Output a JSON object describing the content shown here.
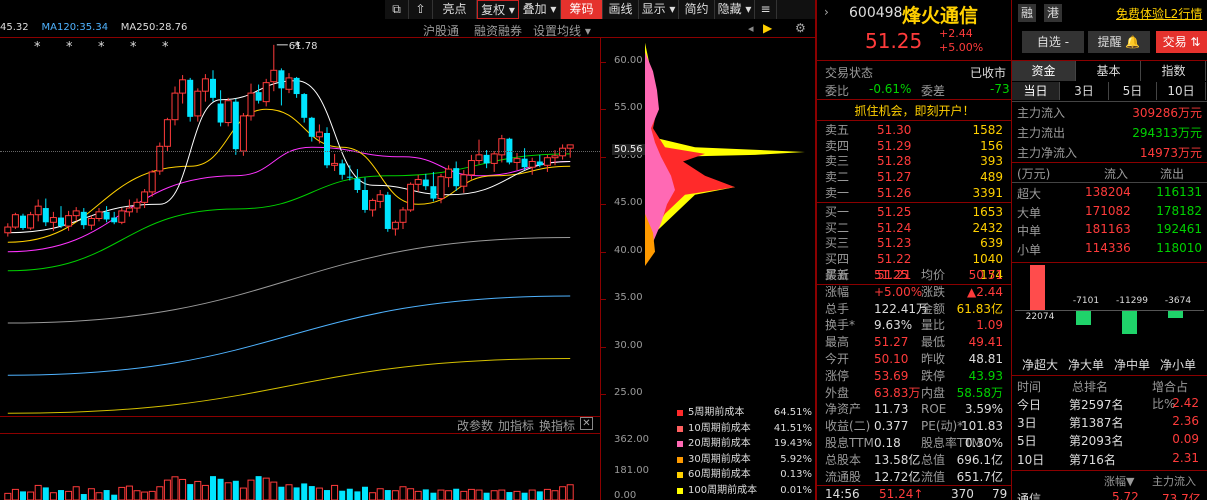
{
  "colors": {
    "up": "#ff3b3b",
    "down": "#00d200",
    "cyan": "#00e5ff",
    "ma5": "#ffffff",
    "ma10": "#ffd000",
    "ma20": "#ff33ff",
    "ma60": "#00d000",
    "ma120": "#9a9a9a",
    "ma250": "#4fb3ff",
    "ma_long": "#d4c000"
  },
  "ma_legend": [
    {
      "text": "45.32",
      "color": "#ddd"
    },
    {
      "text": "MA120:35.34",
      "color": "#4fb3ff"
    },
    {
      "text": "MA250:28.76",
      "color": "#ddd"
    }
  ],
  "toolbar": [
    {
      "label": "",
      "name": "toolbar-icon-button"
    },
    {
      "label": "",
      "name": "toolbar-icon-button-2"
    },
    {
      "label": "亮点",
      "name": "tab-highlights"
    },
    {
      "label": "复权 ▾",
      "name": "tab-adjust",
      "active": "red"
    },
    {
      "label": "叠加 ▾",
      "name": "tab-overlay"
    },
    {
      "label": "筹码",
      "name": "tab-chips",
      "active": "fill"
    },
    {
      "label": "画线",
      "name": "tab-draw"
    },
    {
      "label": "显示 ▾",
      "name": "tab-display"
    },
    {
      "label": "简约",
      "name": "tab-simple"
    },
    {
      "label": "隐藏 ▾",
      "name": "tab-hide"
    },
    {
      "label": "",
      "name": "toolbar-menu-button"
    }
  ],
  "sub_links": [
    "沪股通",
    "融资融券",
    "设置均线 ▾"
  ],
  "peak_label": "61.78",
  "stars": [
    "*",
    "*",
    "*",
    "*",
    "*",
    "*"
  ],
  "price_axis": {
    "ticks": [
      "60.00",
      "55.00",
      "50.00",
      "45.00",
      "40.00",
      "35.00",
      "30.00",
      "25.00"
    ],
    "current": "50.56"
  },
  "volume_axis": {
    "ticks": [
      "362.00",
      "181.00",
      "0.00"
    ]
  },
  "bottom_links": [
    "改参数",
    "加指标",
    "换指标"
  ],
  "chip_legend": [
    {
      "label": "5周期前成本",
      "value": "64.51%",
      "color": "#ff2a2a"
    },
    {
      "label": "10周期前成本",
      "value": "41.51%",
      "color": "#ff6060"
    },
    {
      "label": "20周期前成本",
      "value": "19.43%",
      "color": "#ff69b4"
    },
    {
      "label": "30周期前成本",
      "value": "5.92%",
      "color": "#ff9a00"
    },
    {
      "label": "60周期前成本",
      "value": "0.13%",
      "color": "#ffd000"
    },
    {
      "label": "100周期前成本",
      "value": "0.01%",
      "color": "#ffff00"
    }
  ],
  "chart_data": {
    "type": "candlestick",
    "candles": [
      [
        42,
        43,
        41.6,
        42.6
      ],
      [
        42.6,
        44.1,
        42.4,
        43.9
      ],
      [
        43.8,
        44,
        42.3,
        42.5
      ],
      [
        42.5,
        44.2,
        42.3,
        43.9
      ],
      [
        43.9,
        45.5,
        43.2,
        44.8
      ],
      [
        44.6,
        45.6,
        42.7,
        43.1
      ],
      [
        43.1,
        44.2,
        42.2,
        43.6
      ],
      [
        43.6,
        44.8,
        42.5,
        42.7
      ],
      [
        42.7,
        44.3,
        42.2,
        43.8
      ],
      [
        43.8,
        44.7,
        43.2,
        44.3
      ],
      [
        44.2,
        44.6,
        42.4,
        42.8
      ],
      [
        42.8,
        43.8,
        42.3,
        43.5
      ],
      [
        43.5,
        44.6,
        43.2,
        44.2
      ],
      [
        44.2,
        44.8,
        43.1,
        43.4
      ],
      [
        43.6,
        44.2,
        42.9,
        43.1
      ],
      [
        43.1,
        44.6,
        42.9,
        44.3
      ],
      [
        44.2,
        45.5,
        43.7,
        44.6
      ],
      [
        44.6,
        45.6,
        44.1,
        45.2
      ],
      [
        45.2,
        46.6,
        44.6,
        46.3
      ],
      [
        46.3,
        48.6,
        45.8,
        48.4
      ],
      [
        48.5,
        51.5,
        48.1,
        51.1
      ],
      [
        51.1,
        54.1,
        50.6,
        53.9
      ],
      [
        53.9,
        57.4,
        53.3,
        56.7
      ],
      [
        56.7,
        58.6,
        55.6,
        58.1
      ],
      [
        58.1,
        58.3,
        53.7,
        54.2
      ],
      [
        54.3,
        57.2,
        53.7,
        56.9
      ],
      [
        56.9,
        58.7,
        55.8,
        58.2
      ],
      [
        58.2,
        59.1,
        55.8,
        56.2
      ],
      [
        55.6,
        57,
        53.2,
        53.6
      ],
      [
        53.6,
        56.2,
        53.2,
        55.9
      ],
      [
        55.8,
        56.1,
        50.2,
        50.8
      ],
      [
        50.6,
        54.6,
        50.1,
        54.3
      ],
      [
        54.3,
        57.7,
        53.8,
        56.7
      ],
      [
        56.8,
        57.6,
        55.6,
        55.9
      ],
      [
        55.8,
        58.2,
        55.3,
        57.8
      ],
      [
        57.9,
        61.78,
        56.9,
        59.1
      ],
      [
        59.1,
        59.3,
        55.4,
        57.2
      ],
      [
        57.1,
        58.8,
        56.7,
        58.3
      ],
      [
        58.3,
        58.4,
        56.2,
        56.6
      ],
      [
        56.6,
        56.7,
        53.6,
        54.1
      ],
      [
        54.1,
        54.2,
        51.6,
        52.1
      ],
      [
        52.1,
        53.4,
        51.4,
        52.6
      ],
      [
        52.5,
        53.1,
        48.8,
        49.1
      ],
      [
        49.1,
        50.3,
        48.5,
        49.3
      ],
      [
        49.3,
        49.7,
        47.6,
        48.1
      ],
      [
        47.9,
        49.1,
        47.5,
        47.8
      ],
      [
        47.7,
        48.7,
        46.2,
        46.5
      ],
      [
        46.5,
        47.8,
        44.1,
        44.4
      ],
      [
        44.4,
        45.6,
        43.7,
        45.4
      ],
      [
        45.3,
        46.5,
        44.6,
        46
      ],
      [
        46,
        46.3,
        42.1,
        42.4
      ],
      [
        42.4,
        43.3,
        41.7,
        43.1
      ],
      [
        43.1,
        44.7,
        42.4,
        44.4
      ],
      [
        44.4,
        47.3,
        44.2,
        47.1
      ],
      [
        47.1,
        48.1,
        46.3,
        47.6
      ],
      [
        47.6,
        48.2,
        46.5,
        46.9
      ],
      [
        46.9,
        48.4,
        45.3,
        45.6
      ],
      [
        45.6,
        48.2,
        45.1,
        47.9
      ],
      [
        47.8,
        49.1,
        46.8,
        48.7
      ],
      [
        48.8,
        49.5,
        46.4,
        46.9
      ],
      [
        46.9,
        48.6,
        46.2,
        48.1
      ],
      [
        48.1,
        50.2,
        47.6,
        49.6
      ],
      [
        49.6,
        51.8,
        49.2,
        50.2
      ],
      [
        50.2,
        50.7,
        48.8,
        49.3
      ],
      [
        49.3,
        50.6,
        48.4,
        50.3
      ],
      [
        50.2,
        52.3,
        49.4,
        51.9
      ],
      [
        51.9,
        52,
        49.2,
        49.4
      ],
      [
        49.4,
        50.4,
        48.6,
        49.8
      ],
      [
        49.8,
        50.9,
        48.6,
        48.9
      ],
      [
        48.9,
        49.9,
        48.1,
        49.5
      ],
      [
        49.5,
        50.2,
        48.9,
        49.1
      ],
      [
        49.1,
        50.2,
        48.4,
        49.9
      ],
      [
        49.9,
        50.7,
        49.1,
        50.1
      ],
      [
        50.1,
        51.3,
        49.7,
        50.9
      ],
      [
        50.9,
        51.27,
        49.9,
        51.25
      ]
    ],
    "ma": {
      "ma5": [
        [
          0,
          42
        ],
        [
          20,
          45
        ],
        [
          28,
          56
        ],
        [
          38,
          58
        ],
        [
          48,
          47
        ],
        [
          58,
          46
        ],
        [
          74,
          49.5
        ]
      ],
      "ma10": [
        [
          0,
          41
        ],
        [
          24,
          49
        ],
        [
          34,
          55
        ],
        [
          44,
          51
        ],
        [
          54,
          45
        ],
        [
          64,
          48
        ],
        [
          74,
          49
        ]
      ],
      "ma20": [
        [
          0,
          40
        ],
        [
          30,
          48
        ],
        [
          40,
          51
        ],
        [
          52,
          50
        ],
        [
          62,
          48
        ],
        [
          74,
          49.5
        ]
      ],
      "ma60": [
        [
          0,
          38
        ],
        [
          30,
          44.5
        ],
        [
          50,
          48
        ],
        [
          74,
          50.3
        ]
      ],
      "ma120": [
        [
          0,
          32.5
        ],
        [
          74,
          41.5
        ]
      ],
      "ma250": [
        [
          0,
          27
        ],
        [
          74,
          35.34
        ]
      ],
      "ma_long": [
        [
          0,
          23
        ],
        [
          74,
          28.76
        ]
      ]
    },
    "ylim": [
      22.5,
      62.5
    ],
    "volume": [
      20,
      32,
      26,
      24,
      44,
      38,
      22,
      30,
      26,
      40,
      18,
      34,
      22,
      30,
      16,
      38,
      42,
      28,
      24,
      26,
      40,
      60,
      70,
      62,
      48,
      56,
      44,
      72,
      64,
      52,
      58,
      36,
      60,
      72,
      66,
      54,
      40,
      46,
      38,
      50,
      42,
      36,
      30,
      44,
      28,
      34,
      26,
      40,
      22,
      34,
      30,
      28,
      40,
      34,
      26,
      32,
      22,
      30,
      28,
      34,
      26,
      32,
      30,
      22,
      28,
      30,
      24,
      26,
      22,
      30,
      26,
      32,
      28,
      40,
      46
    ],
    "volume_max": 362
  },
  "stock": {
    "code": "600498",
    "name": "烽火通信",
    "tag1": "融",
    "tag2": "港",
    "free_link": "免费体验L2行情",
    "price": "51.25",
    "change": "+2.44",
    "pct": "+5.00%"
  },
  "buttons": {
    "watch": "自选 -",
    "alert": "提醒",
    "trade": "交易"
  },
  "order_header": {
    "status_label": "交易状态",
    "status": "已收市",
    "ratio_label": "委比",
    "ratio": "-0.61%",
    "diff_label": "委差",
    "diff": "-73"
  },
  "promo": "抓住机会，即刻开户！",
  "asks": [
    {
      "label": "卖五",
      "price": "51.30",
      "vol": "1582"
    },
    {
      "label": "卖四",
      "price": "51.29",
      "vol": "156"
    },
    {
      "label": "卖三",
      "price": "51.28",
      "vol": "393"
    },
    {
      "label": "卖二",
      "price": "51.27",
      "vol": "489"
    },
    {
      "label": "卖一",
      "price": "51.26",
      "vol": "3391"
    }
  ],
  "bids": [
    {
      "label": "买一",
      "price": "51.25",
      "vol": "1653"
    },
    {
      "label": "买二",
      "price": "51.24",
      "vol": "2432"
    },
    {
      "label": "买三",
      "price": "51.23",
      "vol": "639"
    },
    {
      "label": "买四",
      "price": "51.22",
      "vol": "1040"
    },
    {
      "label": "买五",
      "price": "51.21",
      "vol": "174"
    }
  ],
  "stats": [
    {
      "l1": "最新",
      "v1": "51.25",
      "c1": "red",
      "l2": "均价",
      "v2": "50.51",
      "c2": "red"
    },
    {
      "l1": "涨幅",
      "v1": "+5.00%",
      "c1": "red",
      "l2": "涨跌",
      "v2": "▲2.44",
      "c2": "red"
    },
    {
      "l1": "总手",
      "v1": "122.41万",
      "c1": "white",
      "l2": "金额",
      "v2": "61.83亿",
      "c2": "yellow"
    },
    {
      "l1": "换手*",
      "v1": "9.63%",
      "c1": "white",
      "l2": "量比",
      "v2": "1.09",
      "c2": "red"
    },
    {
      "l1": "最高",
      "v1": "51.27",
      "c1": "red",
      "l2": "最低",
      "v2": "49.41",
      "c2": "red"
    },
    {
      "l1": "今开",
      "v1": "50.10",
      "c1": "red",
      "l2": "昨收",
      "v2": "48.81",
      "c2": "white"
    },
    {
      "l1": "涨停",
      "v1": "53.69",
      "c1": "red",
      "l2": "跌停",
      "v2": "43.93",
      "c2": "green"
    },
    {
      "l1": "外盘",
      "v1": "63.83万",
      "c1": "red",
      "l2": "内盘",
      "v2": "58.58万",
      "c2": "green"
    },
    {
      "l1": "净资产",
      "v1": "11.73",
      "c1": "white",
      "l2": "ROE",
      "v2": "3.59%",
      "c2": "white"
    },
    {
      "l1": "收益(二)",
      "v1": "0.377",
      "c1": "white",
      "l2": "PE(动)*",
      "v2": "101.83",
      "c2": "white"
    },
    {
      "l1": "股息TTM",
      "v1": "0.18",
      "c1": "white",
      "l2": "股息率TTM",
      "v2": "0.30%",
      "c2": "white"
    },
    {
      "l1": "总股本",
      "v1": "13.58亿",
      "c1": "white",
      "l2": "总值",
      "v2": "696.1亿",
      "c2": "white"
    },
    {
      "l1": "流通股",
      "v1": "12.72亿",
      "c1": "white",
      "l2": "流值",
      "v2": "651.7亿",
      "c2": "white"
    }
  ],
  "last_trade": {
    "time": "14:56",
    "price": "51.24↑",
    "vol": "370",
    "n": "79"
  },
  "fund": {
    "tabs": [
      "资金",
      "基本",
      "指数"
    ],
    "periods": [
      "当日",
      "3日",
      "5日",
      "10日"
    ],
    "flows": [
      {
        "label": "主力流入",
        "value": "309286万元",
        "color": "red"
      },
      {
        "label": "主力流出",
        "value": "294313万元",
        "color": "green"
      },
      {
        "label": "主力净流入",
        "value": "14973万元",
        "color": "red"
      }
    ],
    "table_head": [
      "(万元)",
      "流入",
      "流出"
    ],
    "table": [
      {
        "label": "超大",
        "in": "138204",
        "out": "116131"
      },
      {
        "label": "大单",
        "in": "171082",
        "out": "178182"
      },
      {
        "label": "中单",
        "in": "181163",
        "out": "192461"
      },
      {
        "label": "小单",
        "in": "114336",
        "out": "118010"
      }
    ],
    "bars": [
      {
        "label": "净超大",
        "value": 22074,
        "text": "22074"
      },
      {
        "label": "净大单",
        "value": -7101,
        "text": "-7101"
      },
      {
        "label": "净中单",
        "value": -11299,
        "text": "-11299"
      },
      {
        "label": "净小单",
        "value": -3674,
        "text": "-3674"
      }
    ],
    "rank_head": [
      "时间",
      "总排名",
      "增合占比%"
    ],
    "ranks": [
      {
        "period": "今日",
        "rank": "第2597名",
        "pct": "2.42"
      },
      {
        "period": "3日",
        "rank": "第1387名",
        "pct": "2.36"
      },
      {
        "period": "5日",
        "rank": "第2093名",
        "pct": "0.09"
      },
      {
        "period": "10日",
        "rank": "第716名",
        "pct": "2.31"
      }
    ],
    "footer": [
      "通信",
      "5.72",
      "73.7亿"
    ],
    "footer_head": [
      "涨幅▼",
      "主力流入"
    ]
  }
}
